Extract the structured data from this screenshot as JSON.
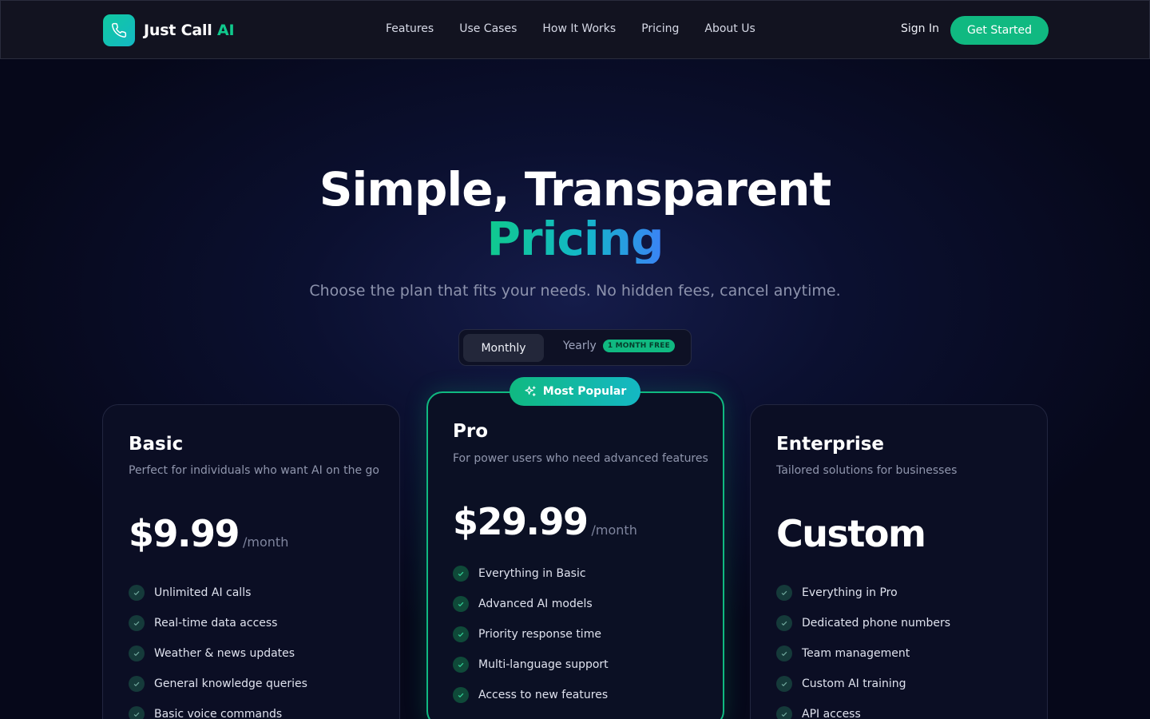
{
  "nav": {
    "logo_text": "Just Call",
    "logo_accent": "AI",
    "links": [
      "Features",
      "Use Cases",
      "How It Works",
      "Pricing",
      "About Us"
    ],
    "sign_in": "Sign In",
    "get_started": "Get Started"
  },
  "hero": {
    "title_line1": "Simple, Transparent",
    "title_line2": "Pricing",
    "subtitle": "Choose the plan that fits your needs. No hidden fees, cancel anytime."
  },
  "billing_toggle": {
    "monthly": "Monthly",
    "yearly": "Yearly",
    "yearly_badge": "1 MONTH FREE",
    "selected": "Monthly"
  },
  "plans": [
    {
      "name": "Basic",
      "description": "Perfect for individuals who want AI on the go",
      "price": "$9.99",
      "period": "/month",
      "features": [
        "Unlimited AI calls",
        "Real-time data access",
        "Weather & news updates",
        "General knowledge queries",
        "Basic voice commands"
      ]
    },
    {
      "name": "Pro",
      "badge": "Most Popular",
      "description": "For power users who need advanced features",
      "price": "$29.99",
      "period": "/month",
      "features": [
        "Everything in Basic",
        "Advanced AI models",
        "Priority response time",
        "Multi-language support",
        "Access to new features"
      ]
    },
    {
      "name": "Enterprise",
      "description": "Tailored solutions for businesses",
      "price": "Custom",
      "period": "",
      "features": [
        "Everything in Pro",
        "Dedicated phone numbers",
        "Team management",
        "Custom AI training",
        "API access"
      ]
    }
  ],
  "colors": {
    "accent_green": "#10b981",
    "accent_teal": "#14b8c4",
    "background": "#06081a"
  }
}
